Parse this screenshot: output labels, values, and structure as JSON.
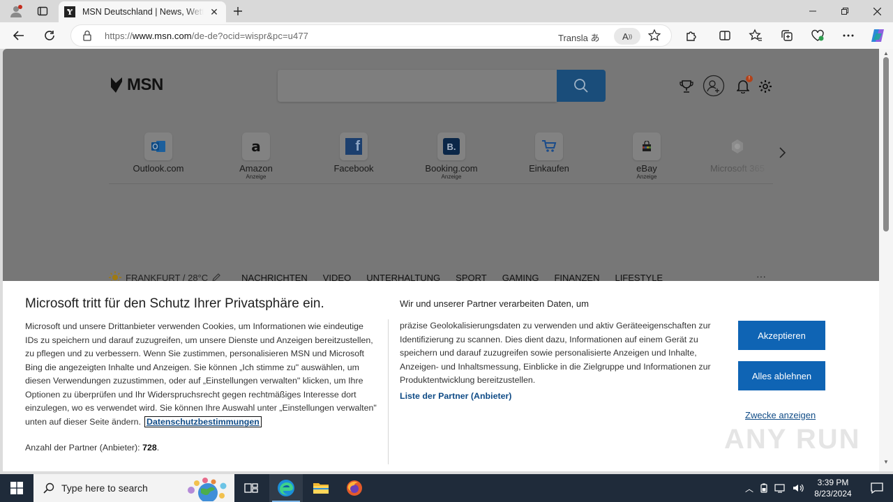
{
  "browser": {
    "tab_title": "MSN Deutschland | News, Wetter, Sport",
    "url_prefix": "https://",
    "url_domain": "www.msn.com",
    "url_path": "/de-de?ocid=wispr&pc=u477",
    "translate_label": "Transla",
    "read_aloud_label": "A"
  },
  "msn": {
    "logo_text": "MSN",
    "notification_count": "!",
    "tiles": [
      {
        "label": "Outlook.com",
        "ad": ""
      },
      {
        "label": "Amazon",
        "ad": "Anzeige"
      },
      {
        "label": "Facebook",
        "ad": ""
      },
      {
        "label": "Booking.com",
        "ad": "Anzeige"
      },
      {
        "label": "Einkaufen",
        "ad": ""
      },
      {
        "label": "eBay",
        "ad": "Anzeige"
      },
      {
        "label": "Microsoft 365",
        "ad": ""
      }
    ],
    "weather": "FRANKFURT / 28°C",
    "nav": [
      "NACHRICHTEN",
      "VIDEO",
      "UNTERHALTUNG",
      "SPORT",
      "GAMING",
      "FINANZEN",
      "LIFESTYLE"
    ],
    "nav_more": "···"
  },
  "consent": {
    "heading": "Microsoft tritt für den Schutz Ihrer Privatsphäre ein.",
    "body": "Microsoft und unsere Drittanbieter verwenden Cookies, um Informationen wie eindeutige IDs zu speichern und darauf zuzugreifen, um unsere Dienste und Anzeigen bereitzustellen, zu pflegen und zu verbessern. Wenn Sie zustimmen, personalisieren MSN und Microsoft Bing die angezeigten Inhalte und Anzeigen. Sie können „Ich stimme zu\" auswählen, um diesen Verwendungen zuzustimmen, oder auf „Einstellungen verwalten\" klicken, um Ihre Optionen zu überprüfen und Ihr Widerspruchsrecht gegen rechtmäßiges Interesse dort einzulegen, wo es verwendet wird.  Sie können Ihre Auswahl unter „Einstellungen verwalten\" unten auf dieser Seite ändern.",
    "privacy_link": "Datenschutzbestimmungen",
    "partner_count_label": "Anzahl der Partner (Anbieter):",
    "partner_count_value": "728",
    "purpose_title": "Wir und unserer Partner verarbeiten Daten, um",
    "purpose_text": "präzise Geolokalisierungsdaten zu verwenden und aktiv Geräteeigenschaften zur Identifizierung zu scannen. Dies dient dazu, Informationen auf einem Gerät zu speichern und darauf zuzugreifen sowie personalisierte Anzeigen und Inhalte, Anzeigen- und Inhaltsmessung, Einblicke in die Zielgruppe und Informationen zur Produktentwicklung bereitzustellen.",
    "partner_list_link": "Liste der Partner (Anbieter)",
    "accept_label": "Akzeptieren",
    "reject_label": "Alles ablehnen",
    "purposes_link": "Zwecke anzeigen"
  },
  "watermark": "ANY RUN",
  "taskbar": {
    "search_placeholder": "Type here to search",
    "time": "3:39 PM",
    "date": "8/23/2024"
  }
}
